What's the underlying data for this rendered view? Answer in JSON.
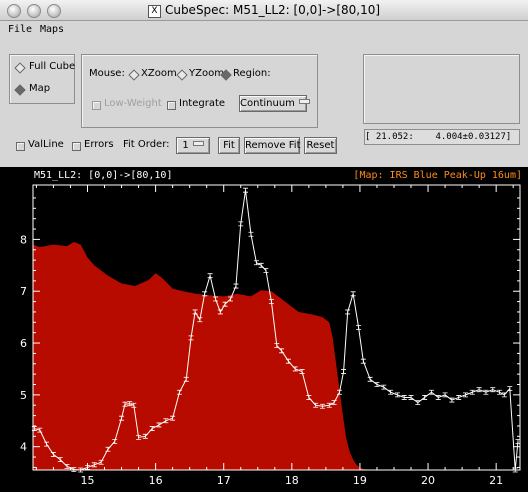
{
  "window": {
    "title": "CubeSpec: M51_LL2: [0,0]->[80,10]"
  },
  "menu": {
    "items": [
      "File",
      "Maps"
    ]
  },
  "mode": {
    "full_cube": "Full Cube",
    "map": "Map",
    "selected": "Map"
  },
  "mouse": {
    "label": "Mouse:",
    "xzoom": "XZoom",
    "yzoom": "YZoom",
    "region": "Region:"
  },
  "options": {
    "low_weight": "Low-Weight",
    "integrate": "Integrate",
    "continuum": "Continuum"
  },
  "controls": {
    "valline": "ValLine",
    "errors": "Errors",
    "fit_order_label": "Fit Order:",
    "fit_order_value": "1",
    "fit": "Fit",
    "remove_fit": "Remove Fit",
    "reset": "Reset"
  },
  "readout": "[ 21.052:    4.004±0.03127]",
  "plot": {
    "title_left": "M51_LL2: [0,0]->[80,10]",
    "title_right": "[Map: IRS Blue Peak-Up 16um]"
  },
  "colors": {
    "spectrum": "#ffffff",
    "filter_curve": "#b80b00",
    "plot_bg": "#000000",
    "map_label": "#ff8c1a"
  },
  "chart_data": {
    "type": "line",
    "xlim": [
      14.2,
      21.35
    ],
    "ylim": [
      3.55,
      9.05
    ],
    "xticks": [
      15,
      16,
      17,
      18,
      19,
      20,
      21
    ],
    "xtick_labels": [
      "15",
      "16",
      "17",
      "18",
      "19",
      "20",
      "21"
    ],
    "yticks": [
      4,
      5,
      6,
      7,
      8
    ],
    "ytick_labels": [
      "4",
      "5",
      "6",
      "7",
      "8"
    ],
    "spectrum": {
      "x": [
        14.22,
        14.3,
        14.4,
        14.5,
        14.6,
        14.7,
        14.8,
        14.9,
        15.0,
        15.1,
        15.2,
        15.3,
        15.4,
        15.5,
        15.55,
        15.62,
        15.68,
        15.75,
        15.85,
        15.95,
        16.05,
        16.15,
        16.25,
        16.35,
        16.45,
        16.52,
        16.58,
        16.65,
        16.72,
        16.8,
        16.88,
        16.95,
        17.02,
        17.1,
        17.18,
        17.25,
        17.32,
        17.4,
        17.48,
        17.55,
        17.62,
        17.7,
        17.78,
        17.85,
        17.95,
        18.05,
        18.15,
        18.25,
        18.35,
        18.45,
        18.55,
        18.62,
        18.7,
        18.76,
        18.82,
        18.9,
        18.98,
        19.05,
        19.15,
        19.25,
        19.35,
        19.45,
        19.55,
        19.65,
        19.75,
        19.85,
        19.95,
        20.05,
        20.15,
        20.25,
        20.35,
        20.45,
        20.55,
        20.65,
        20.75,
        20.85,
        20.95,
        21.05,
        21.12,
        21.2,
        21.28,
        21.32
      ],
      "y": [
        4.35,
        4.32,
        4.05,
        3.85,
        3.75,
        3.62,
        3.56,
        3.55,
        3.6,
        3.65,
        3.7,
        3.95,
        4.1,
        4.55,
        4.82,
        4.83,
        4.8,
        4.18,
        4.2,
        4.35,
        4.42,
        4.5,
        4.55,
        5.05,
        5.3,
        6.1,
        6.6,
        6.45,
        6.95,
        7.3,
        6.85,
        6.6,
        6.75,
        6.85,
        7.1,
        8.3,
        8.95,
        8.1,
        7.55,
        7.5,
        7.4,
        6.8,
        5.95,
        5.85,
        5.65,
        5.5,
        5.45,
        4.95,
        4.8,
        4.78,
        4.8,
        4.85,
        5.05,
        5.45,
        6.6,
        6.95,
        6.3,
        5.65,
        5.3,
        5.2,
        5.15,
        5.05,
        5.0,
        4.95,
        4.95,
        4.85,
        4.95,
        5.05,
        4.95,
        5.0,
        4.9,
        4.95,
        5.0,
        5.05,
        5.1,
        5.05,
        5.1,
        5.05,
        5.0,
        5.12,
        3.55,
        4.1
      ]
    },
    "filter_curve": {
      "x": [
        14.2,
        14.3,
        14.5,
        14.7,
        14.8,
        14.9,
        15.0,
        15.1,
        15.3,
        15.5,
        15.7,
        15.9,
        16.0,
        16.1,
        16.25,
        16.4,
        16.6,
        16.8,
        17.0,
        17.2,
        17.4,
        17.55,
        17.7,
        17.9,
        18.1,
        18.3,
        18.45,
        18.55,
        18.6,
        18.65,
        18.7,
        18.75,
        18.8,
        18.85,
        18.9,
        18.95,
        19.0,
        19.05,
        19.1,
        19.15,
        19.2
      ],
      "y": [
        7.9,
        7.85,
        7.9,
        7.87,
        7.95,
        7.9,
        7.65,
        7.5,
        7.3,
        7.15,
        7.1,
        7.22,
        7.35,
        7.25,
        7.05,
        7.0,
        6.95,
        6.92,
        6.9,
        6.95,
        6.9,
        7.02,
        7.0,
        6.8,
        6.6,
        6.55,
        6.5,
        6.4,
        6.1,
        5.6,
        5.1,
        4.6,
        4.15,
        3.9,
        3.75,
        3.65,
        3.6,
        3.57,
        3.56,
        3.55,
        3.55
      ]
    }
  }
}
